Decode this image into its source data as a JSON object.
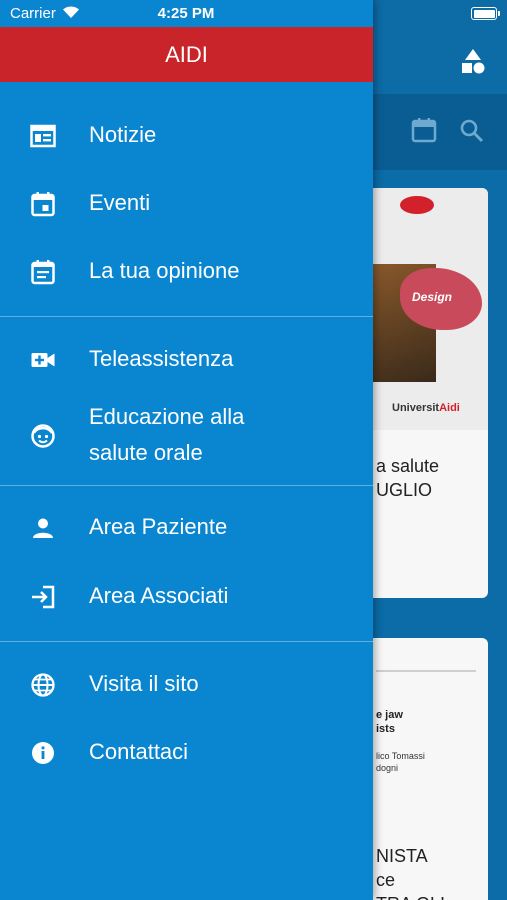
{
  "status_bar": {
    "carrier": "Carrier",
    "time": "4:25 PM"
  },
  "drawer": {
    "title": "AIDI",
    "sections": [
      {
        "items": [
          {
            "label": "Notizie",
            "icon": "newspaper-icon"
          },
          {
            "label": "Eventi",
            "icon": "calendar-event-icon"
          },
          {
            "label": "La tua opinione",
            "icon": "feedback-icon"
          }
        ]
      },
      {
        "items": [
          {
            "label": "Teleassistenza",
            "icon": "video-call-icon"
          },
          {
            "label": "Educazione alla\nsalute orale",
            "icon": "child-face-icon"
          }
        ]
      },
      {
        "items": [
          {
            "label": "Area Paziente",
            "icon": "person-icon"
          },
          {
            "label": "Area Associati",
            "icon": "login-icon"
          }
        ]
      },
      {
        "items": [
          {
            "label": "Visita il sito",
            "icon": "globe-icon"
          },
          {
            "label": "Contattaci",
            "icon": "info-icon"
          }
        ]
      }
    ]
  },
  "background": {
    "card1": {
      "poster_art": "Design",
      "poster_brand_a": "Universit",
      "poster_brand_b": "Aidi",
      "text": "a salute\nUGLIO"
    },
    "card2": {
      "doc_title": "e jaw\nists",
      "doc_authors": "lico Tomassi\ndogni",
      "text": "NISTA\nce\nTRA GLI"
    }
  },
  "colors": {
    "drawer": "#0a86d1",
    "header": "#c8242a",
    "background_app": "#0b6ca8"
  }
}
